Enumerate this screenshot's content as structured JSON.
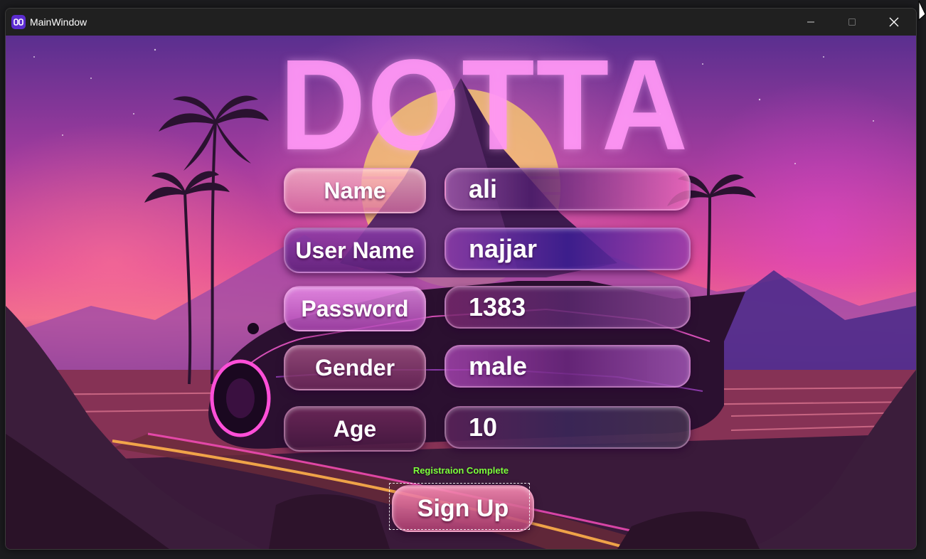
{
  "window": {
    "title": "MainWindow",
    "icon": "app-logo-icon",
    "controls": {
      "minimize": "minimize-icon",
      "maximize": "maximize-icon",
      "close": "close-icon"
    }
  },
  "brand": {
    "text": "DOTTA"
  },
  "form": {
    "fields": [
      {
        "label": "Name",
        "value": "ali"
      },
      {
        "label": "User Name",
        "value": "najjar"
      },
      {
        "label": "Password",
        "value": "1383"
      },
      {
        "label": "Gender",
        "value": "male"
      },
      {
        "label": "Age",
        "value": "10"
      }
    ],
    "status": "Registraion Complete",
    "submit_label": "Sign Up"
  },
  "colors": {
    "status_text": "#7dff3c",
    "accent_pink": "#f06d8c",
    "accent_purple": "#5a2f8f"
  }
}
